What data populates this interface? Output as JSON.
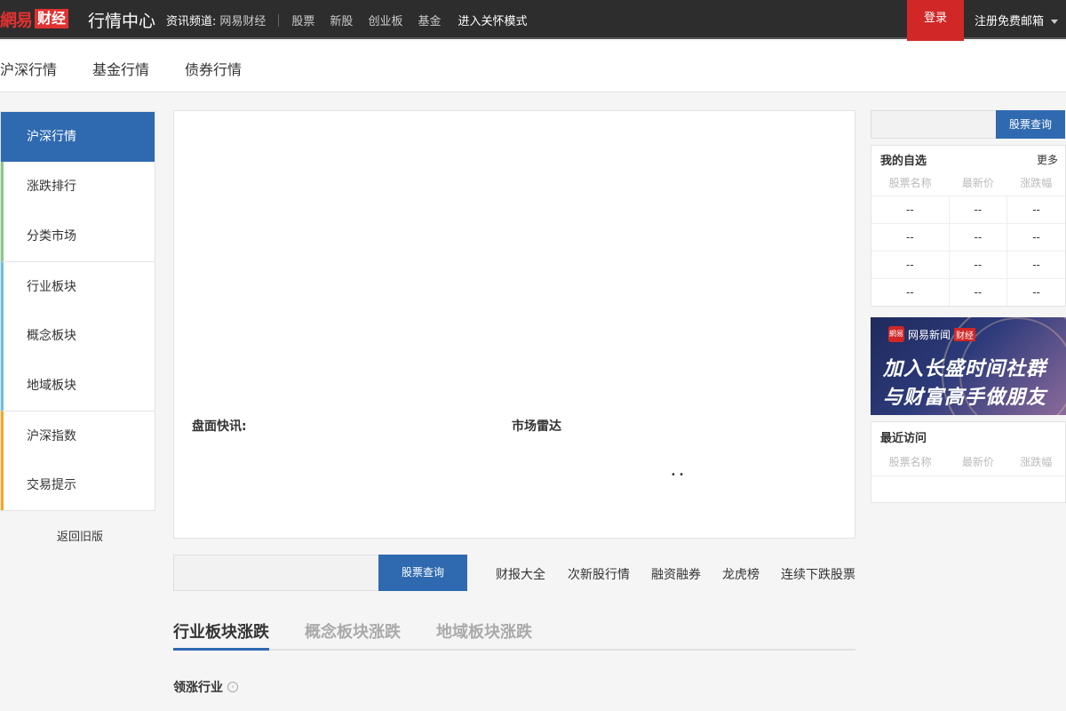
{
  "header": {
    "logo_left": "網易",
    "logo_right": "财经",
    "title": "行情中心",
    "channel_label": "资讯频道:",
    "channel_link": "网易财经",
    "links": [
      "股票",
      "新股",
      "创业板",
      "基金"
    ],
    "nostalgia_mode": "进入关怀模式",
    "login": "登录",
    "register": "注册免费邮箱"
  },
  "subnav": [
    "沪深行情",
    "基金行情",
    "债券行情"
  ],
  "sidebar": {
    "items": [
      "沪深行情",
      "涨跌排行",
      "分类市场",
      "行业板块",
      "概念板块",
      "地域板块",
      "沪深指数",
      "交易提示"
    ],
    "old_version": "返回旧版"
  },
  "panel": {
    "news_label": "盘面快讯:",
    "radar_label": "市场雷达",
    "loading": "• •"
  },
  "search": {
    "button": "股票查询",
    "quick_links": [
      "财报大全",
      "次新股行情",
      "融资融券",
      "龙虎榜",
      "连续下跌股票"
    ]
  },
  "tabs": [
    "行业板块涨跌",
    "概念板块涨跌",
    "地域板块涨跌"
  ],
  "lead_industry": "领涨行业",
  "right": {
    "search_button": "股票查询",
    "watchlist": {
      "title": "我的自选",
      "more": "更多",
      "columns": [
        "股票名称",
        "最新价",
        "涨跌幅"
      ],
      "rows": [
        [
          "--",
          "--",
          "--"
        ],
        [
          "--",
          "--",
          "--"
        ],
        [
          "--",
          "--",
          "--"
        ],
        [
          "--",
          "--",
          "--"
        ]
      ]
    },
    "banner": {
      "logo_icon": "網易",
      "brand": "网易新闻",
      "tag": "财经",
      "line1": "加入长盛时间社群",
      "line2": "与财富高手做朋友"
    },
    "recent": {
      "title": "最近访问",
      "columns": [
        "股票名称",
        "最新价",
        "涨跌幅"
      ]
    }
  }
}
